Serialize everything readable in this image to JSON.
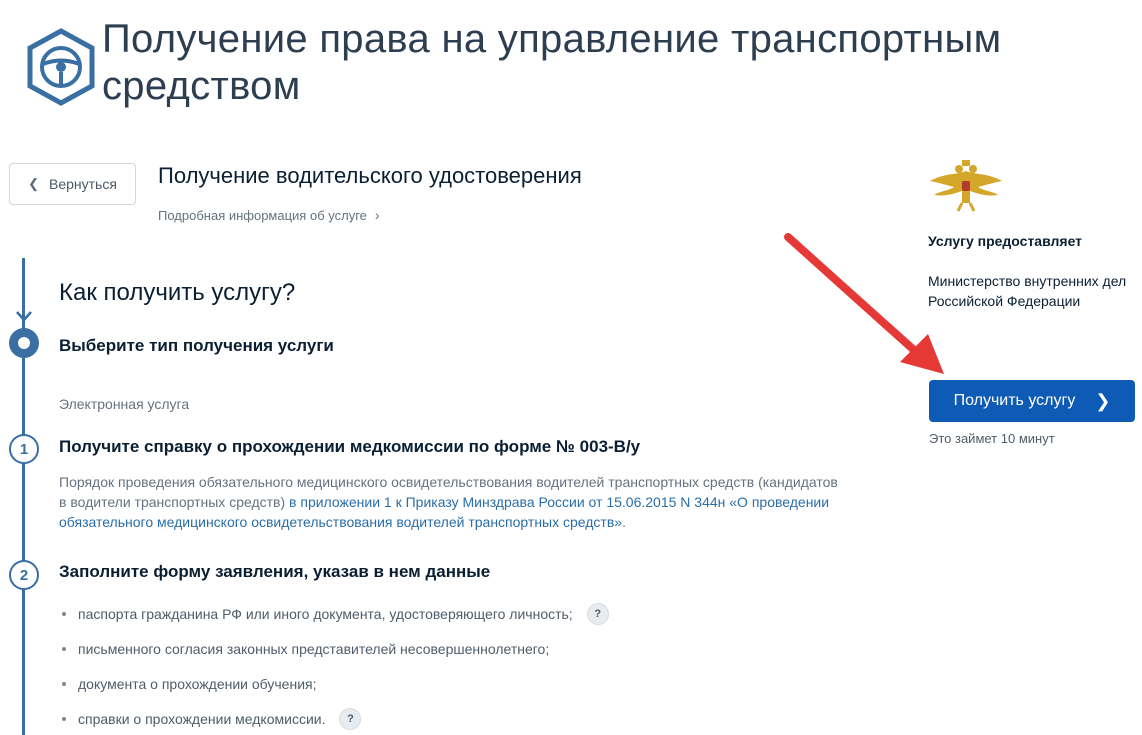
{
  "header": {
    "title": "Получение права на управление транспортным средством",
    "logo_icon": "steering-wheel-icon"
  },
  "nav": {
    "back_label": "Вернуться"
  },
  "service": {
    "title": "Получение водительского удостоверения",
    "details_link": "Подробная информация об услуге"
  },
  "how": {
    "title": "Как получить услугу?",
    "step0": {
      "title": "Выберите тип получения услуги",
      "option": "Электронная услуга"
    },
    "step1": {
      "number": "1",
      "title": "Получите справку о прохождении медкомиссии по форме № 003-В/у",
      "text": "Порядок проведения обязательного медицинского освидетельствования водителей транспортных средств (кандидатов в водители транспортных средств) ",
      "link": "в приложении 1 к Приказу Минздрава России от 15.06.2015 N 344н «О проведении обязательного медицинского освидетельствования водителей транспортных средств»",
      "end": "."
    },
    "step2": {
      "number": "2",
      "title": "Заполните форму заявления, указав в нем данные",
      "items": [
        "паспорта гражданина РФ или иного документа, удостоверяющего личность;",
        "письменного согласия законных представителей несовершеннолетнего;",
        "документа о прохождении обучения;",
        "справки о прохождении медкомиссии."
      ],
      "help_label": "?"
    }
  },
  "provider": {
    "label": "Услугу предоставляет",
    "name": "Министерство внутренних дел Российской Федерации",
    "emblem_icon": "double-headed-eagle-icon"
  },
  "action": {
    "button_label": "Получить услугу",
    "time_note": "Это займет 10 минут"
  },
  "colors": {
    "primary": "#0d5bb5",
    "timeline": "#3a6fa3",
    "link": "#2a6ea8",
    "annotation_arrow": "#e53935"
  }
}
